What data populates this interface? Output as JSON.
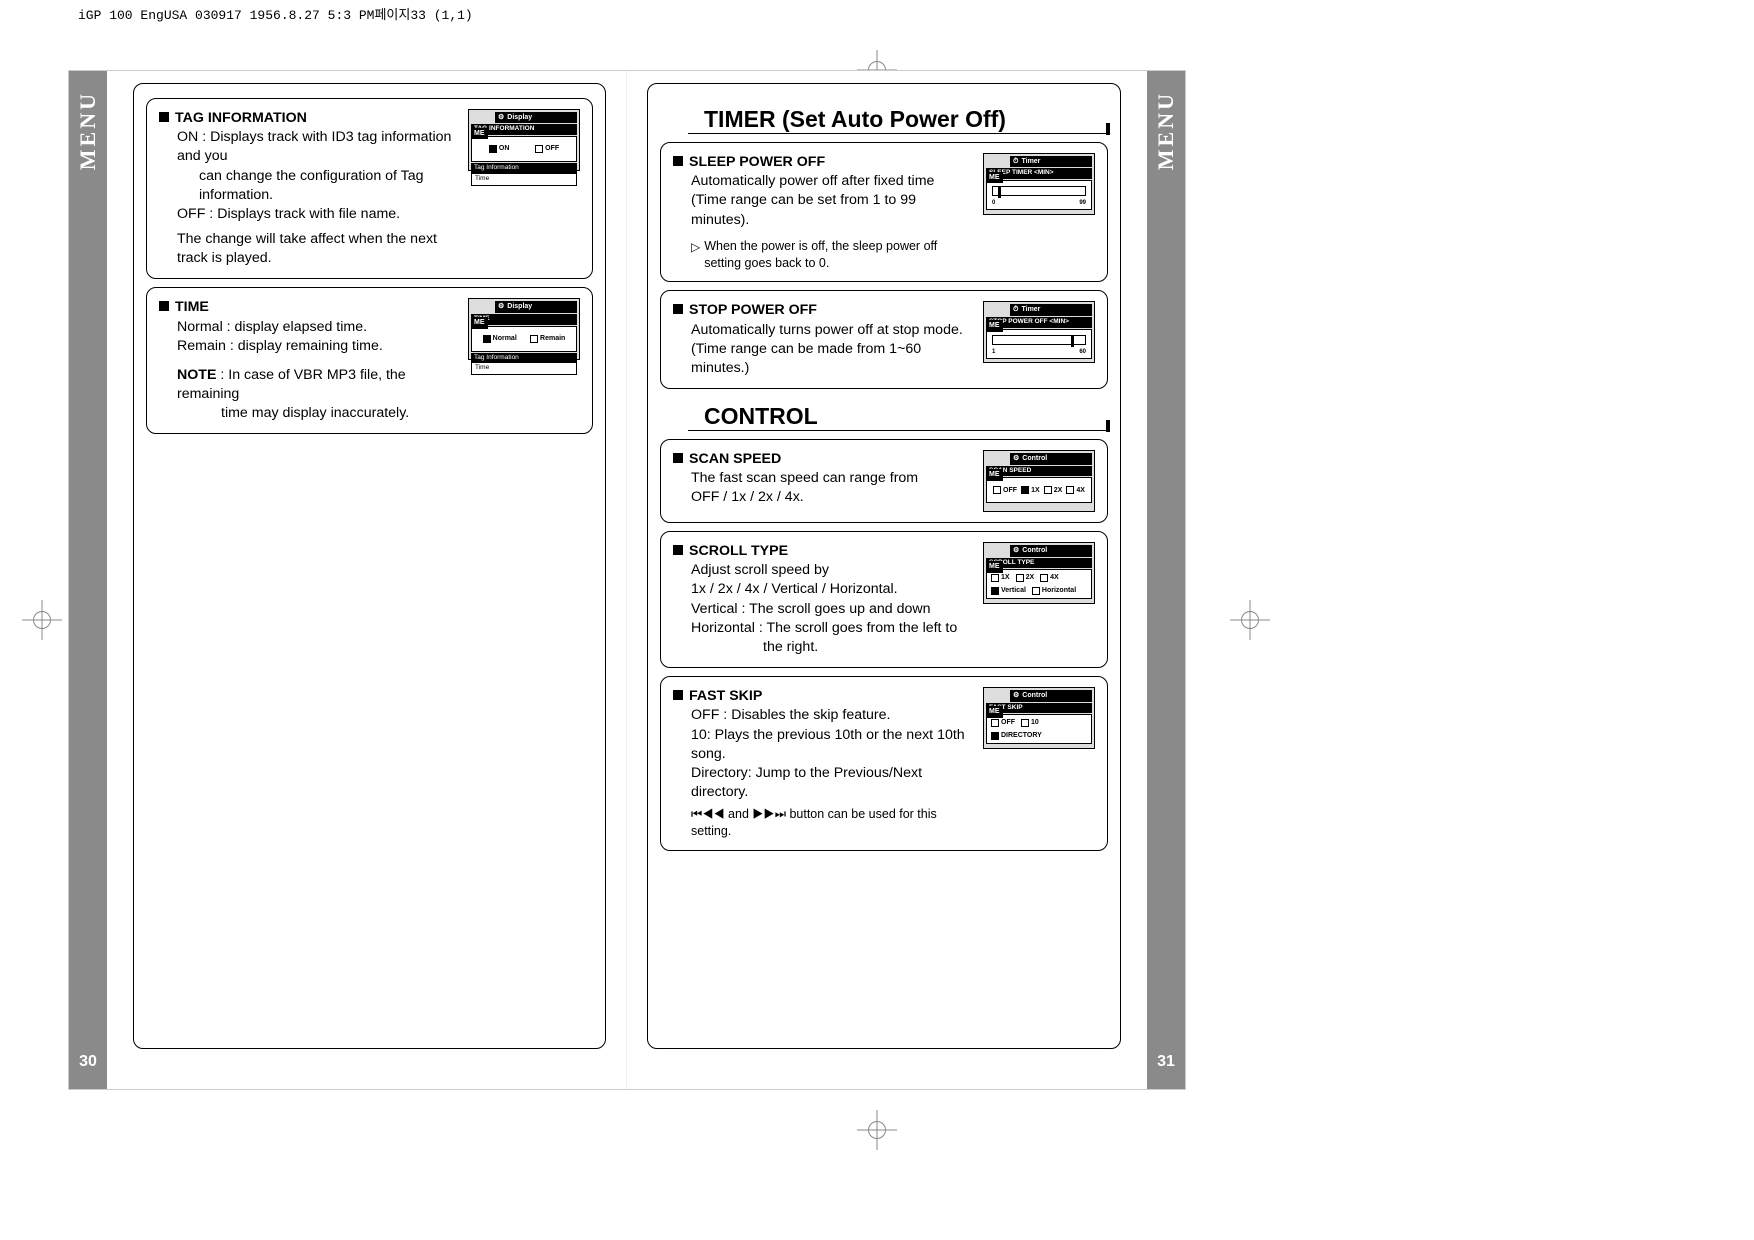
{
  "header_strip": "iGP 100 EngUSA 030917  1956.8.27 5:3 PM페이지33 (1,1)",
  "tabs": {
    "left": "MENU",
    "right": "MENU"
  },
  "page_numbers": {
    "left": "30",
    "right": "31"
  },
  "left_page": {
    "box1": {
      "title": "TAG INFORMATION",
      "line1": "ON : Displays track with ID3 tag information and you",
      "line1b": "can change the configuration of Tag information.",
      "line2": "OFF : Displays track with file name.",
      "line3": "The change will take affect when the next track is played.",
      "lcd": {
        "header": "Display",
        "sub": "TAG INFORMATION",
        "me": "ME",
        "opts": [
          "ON",
          "OFF"
        ],
        "selected": 0,
        "foot1": "Tag Information",
        "foot2": "Time"
      }
    },
    "box2": {
      "title": "TIME",
      "line1": "Normal : display elapsed time.",
      "line2": "Remain : display remaining time.",
      "note_label": "NOTE",
      "note": ": In case of VBR MP3 file, the remaining",
      "note2": "time may display inaccurately.",
      "lcd": {
        "header": "Display",
        "sub": "TIME",
        "me": "ME",
        "opts": [
          "Normal",
          "Remain"
        ],
        "selected": 0,
        "foot1": "Tag Information",
        "foot2": "Time"
      }
    }
  },
  "right_page": {
    "section1": "TIMER (Set Auto Power Off)",
    "box1": {
      "title": "SLEEP POWER OFF",
      "line1": "Automatically power off after fixed time",
      "line2": "(Time range can be set from 1 to 99 minutes).",
      "note": "When the power is off, the sleep power off setting goes back to 0.",
      "lcd": {
        "header": "Timer",
        "sub": "SLEEP TIMER <MIN>",
        "me": "ME",
        "min": "0",
        "max": "99",
        "knob_pct": 5
      }
    },
    "box2": {
      "title": "STOP POWER OFF",
      "line1": "Automatically turns power off at stop mode.",
      "line2": "(Time range can be made from 1~60 minutes.)",
      "lcd": {
        "header": "Timer",
        "sub": "STOP POWER OFF <MIN>",
        "me": "ME",
        "min": "1",
        "max": "60",
        "knob_pct": 85
      }
    },
    "section2": "CONTROL",
    "box3": {
      "title": "SCAN SPEED",
      "line1": "The fast scan speed can range from",
      "line2": "OFF / 1x / 2x / 4x.",
      "lcd": {
        "header": "Control",
        "sub": "SCAN SPEED",
        "me": "ME",
        "opts": [
          "OFF",
          "1X",
          "2X",
          "4X"
        ],
        "selected": 1
      }
    },
    "box4": {
      "title": "SCROLL TYPE",
      "line1": "Adjust scroll speed by",
      "line2": "1x / 2x / 4x / Vertical / Horizontal.",
      "line3": "Vertical : The scroll goes up and down",
      "line4": "Horizontal : The scroll goes from the left to",
      "line4b": "the right.",
      "lcd": {
        "header": "Control",
        "sub": "SCROLL TYPE",
        "me": "ME",
        "row1": [
          "1X",
          "2X",
          "4X"
        ],
        "row1_selected": -1,
        "row2": [
          "Vertical",
          "Horizontal"
        ],
        "row2_selected": 0
      }
    },
    "box5": {
      "title": "FAST SKIP",
      "line1": "OFF : Disables the skip feature.",
      "line2": "10: Plays the previous 10th or the next 10th song.",
      "line3": "Directory: Jump to the Previous/Next directory.",
      "foot_a": "⏮◀◀",
      "foot_mid": "and",
      "foot_b": "▶▶⏭",
      "foot_end": "button can be used for this setting.",
      "lcd": {
        "header": "Control",
        "sub": "FAST SKIP",
        "me": "ME",
        "row1": [
          "OFF",
          "10"
        ],
        "row1_selected": -1,
        "row2": [
          "DIRECTORY"
        ],
        "row2_selected": 0
      }
    }
  }
}
